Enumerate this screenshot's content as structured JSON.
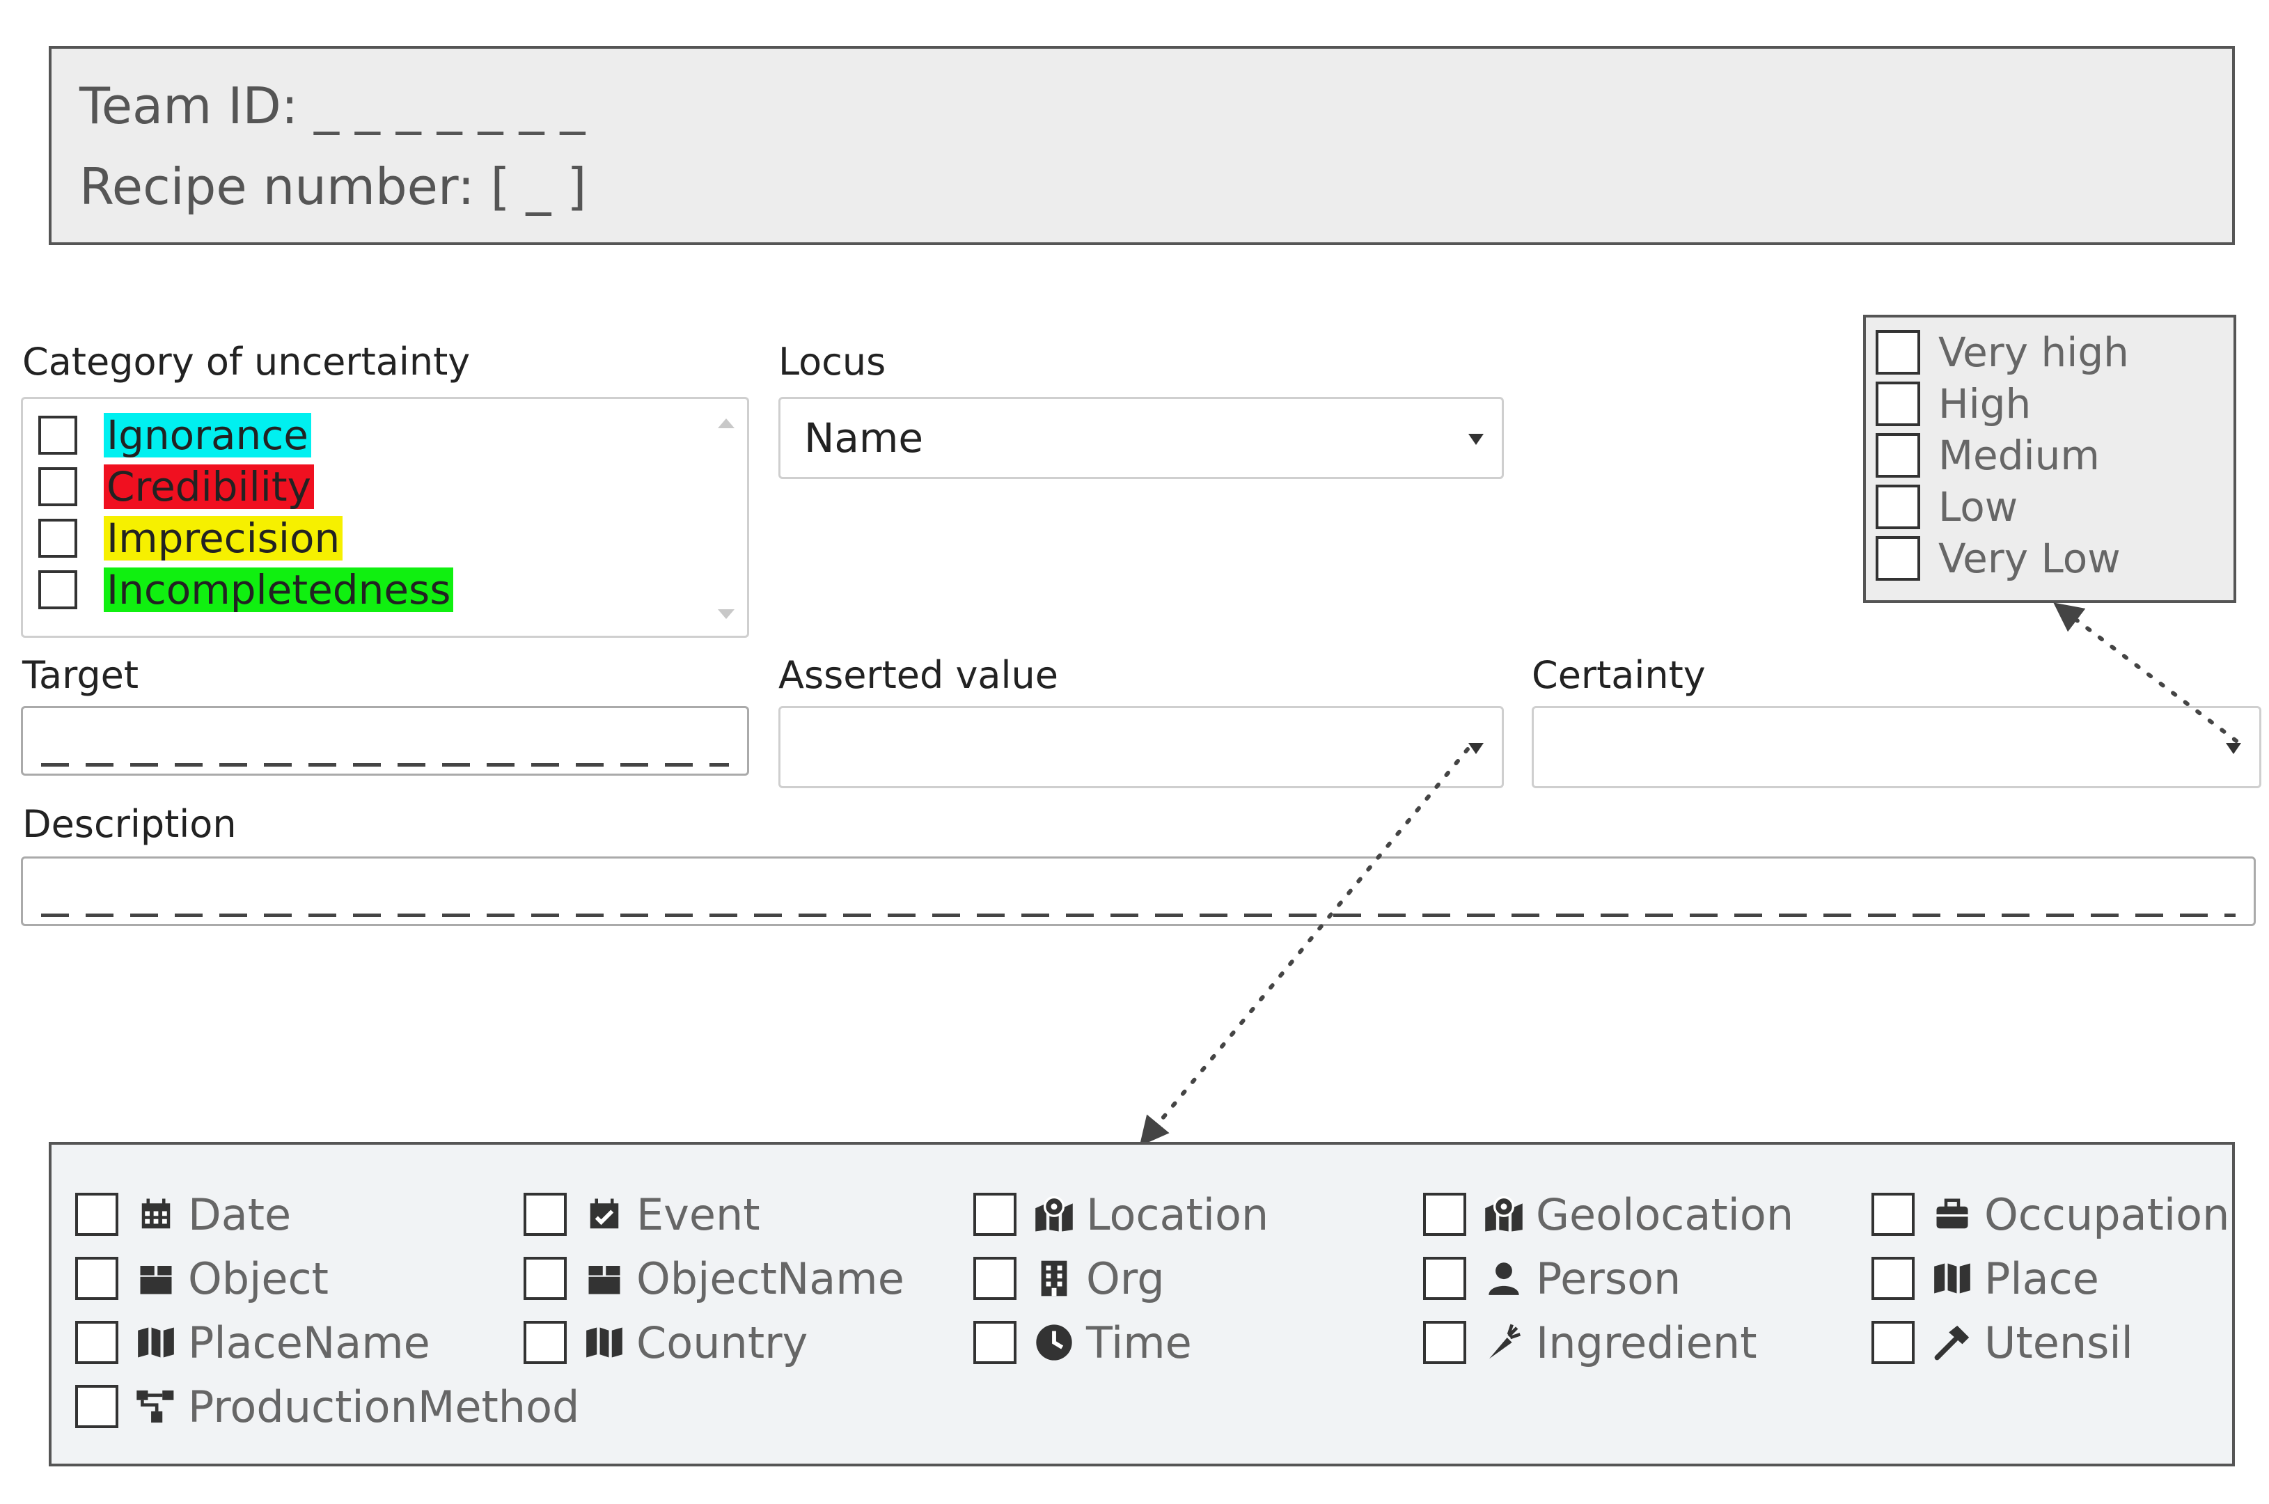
{
  "header": {
    "team_id": "Team ID: _ _ _ _ _ _ _",
    "recipe_number": "Recipe number: [ _ ]"
  },
  "category": {
    "label": "Category of uncertainty",
    "items": [
      {
        "label": "Ignorance",
        "color": "#00f0f0"
      },
      {
        "label": "Credibility",
        "color": "#f01020"
      },
      {
        "label": "Imprecision",
        "color": "#f6f000"
      },
      {
        "label": "Incompletedness",
        "color": "#10f010"
      }
    ]
  },
  "locus": {
    "label": "Locus",
    "value": "Name"
  },
  "target": {
    "label": "Target"
  },
  "asserted_value": {
    "label": "Asserted value"
  },
  "certainty": {
    "label": "Certainty"
  },
  "description": {
    "label": "Description"
  },
  "certainty_options": [
    "Very high",
    "High",
    "Medium",
    "Low",
    "Very Low"
  ],
  "entity_types": [
    {
      "label": "Date",
      "icon": "calendar-icon"
    },
    {
      "label": "Event",
      "icon": "calendar-check-icon"
    },
    {
      "label": "Location",
      "icon": "map-marker-icon"
    },
    {
      "label": "Geolocation",
      "icon": "map-marker-icon"
    },
    {
      "label": "Occupation",
      "icon": "briefcase-icon"
    },
    {
      "label": "Object",
      "icon": "box-icon"
    },
    {
      "label": "ObjectName",
      "icon": "box-icon"
    },
    {
      "label": "Org",
      "icon": "building-icon"
    },
    {
      "label": "Person",
      "icon": "user-icon"
    },
    {
      "label": "Place",
      "icon": "map-icon"
    },
    {
      "label": "PlaceName",
      "icon": "map-icon"
    },
    {
      "label": "Country",
      "icon": "map-icon"
    },
    {
      "label": "Time",
      "icon": "clock-icon"
    },
    {
      "label": "Ingredient",
      "icon": "carrot-icon"
    },
    {
      "label": "Utensil",
      "icon": "hammer-icon"
    },
    {
      "label": "ProductionMethod",
      "icon": "sitemap-icon"
    }
  ]
}
